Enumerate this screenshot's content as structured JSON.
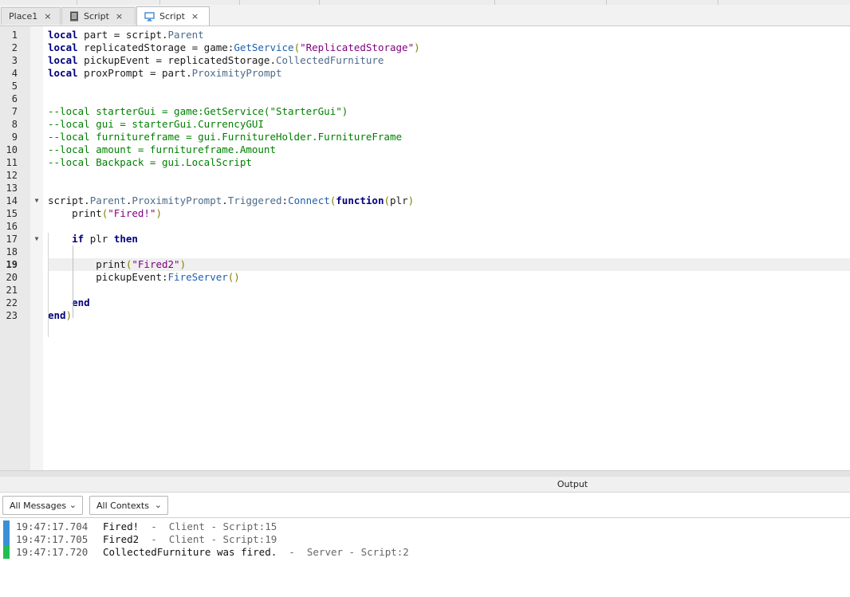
{
  "tabs": [
    {
      "label": "Place1",
      "icon": "none",
      "close": "×"
    },
    {
      "label": "Script",
      "icon": "script-doc-icon",
      "close": "×"
    },
    {
      "label": "Script",
      "icon": "monitor-icon",
      "close": "×"
    }
  ],
  "editor": {
    "current_line": 19,
    "lines": [
      {
        "n": "1",
        "fold": "",
        "html": "<span class='kw'>local</span> part = script.<span class='mem'>Parent</span>"
      },
      {
        "n": "2",
        "fold": "",
        "html": "<span class='kw'>local</span> replicatedStorage = game:<span class='meth'>GetService</span><span class='par'>(</span><span class='str'>\"ReplicatedStorage\"</span><span class='par'>)</span>"
      },
      {
        "n": "3",
        "fold": "",
        "html": "<span class='kw'>local</span> pickupEvent = replicatedStorage.<span class='mem'>CollectedFurniture</span>"
      },
      {
        "n": "4",
        "fold": "",
        "html": "<span class='kw'>local</span> proxPrompt = part.<span class='mem'>ProximityPrompt</span>"
      },
      {
        "n": "5",
        "fold": "",
        "html": ""
      },
      {
        "n": "6",
        "fold": "",
        "html": ""
      },
      {
        "n": "7",
        "fold": "",
        "html": "<span class='cmt'>--local starterGui = game:GetService(\"StarterGui\")</span>"
      },
      {
        "n": "8",
        "fold": "",
        "html": "<span class='cmt'>--local gui = starterGui.CurrencyGUI</span>"
      },
      {
        "n": "9",
        "fold": "",
        "html": "<span class='cmt'>--local furnitureframe = gui.FurnitureHolder.FurnitureFrame</span>"
      },
      {
        "n": "10",
        "fold": "",
        "html": "<span class='cmt'>--local amount = furnitureframe.Amount</span>"
      },
      {
        "n": "11",
        "fold": "",
        "html": "<span class='cmt'>--local Backpack = gui.LocalScript</span>"
      },
      {
        "n": "12",
        "fold": "",
        "html": ""
      },
      {
        "n": "13",
        "fold": "",
        "html": ""
      },
      {
        "n": "14",
        "fold": "▼",
        "html": "script.<span class='mem'>Parent</span>.<span class='mem'>ProximityPrompt</span>.<span class='mem'>Triggered</span>:<span class='meth'>Connect</span><span class='par'>(</span><span class='kw'>function</span><span class='par'>(</span>plr<span class='par'>)</span>"
      },
      {
        "n": "15",
        "fold": "",
        "html": "    print<span class='par'>(</span><span class='str'>\"Fired!\"</span><span class='par'>)</span>"
      },
      {
        "n": "16",
        "fold": "",
        "html": ""
      },
      {
        "n": "17",
        "fold": "▼",
        "html": "    <span class='kw'>if</span> plr <span class='kw'>then</span>"
      },
      {
        "n": "18",
        "fold": "",
        "html": ""
      },
      {
        "n": "19",
        "fold": "",
        "html": "        print<span class='par'>(</span><span class='str'>\"Fired2\"</span><span class='par'>)</span>"
      },
      {
        "n": "20",
        "fold": "",
        "html": "        pickupEvent:<span class='meth'>FireServer</span><span class='par'>()</span>"
      },
      {
        "n": "21",
        "fold": "",
        "html": ""
      },
      {
        "n": "22",
        "fold": "",
        "html": "    <span class='kw'>end</span>"
      },
      {
        "n": "23",
        "fold": "",
        "html": "<span class='kw'>end</span><span class='par'>)</span>"
      }
    ]
  },
  "output": {
    "title": "Output",
    "filter_messages": "All Messages",
    "filter_contexts": "All Contexts",
    "chevron": "⌄",
    "colors": {
      "client": "#3a8fd6",
      "server": "#1fbf4f"
    },
    "entries": [
      {
        "time": "19:47:17.704",
        "message": "Fired!",
        "source": "  -  Client - Script:15",
        "context": "client"
      },
      {
        "time": "19:47:17.705",
        "message": "Fired2",
        "source": "  -  Client - Script:19",
        "context": "client"
      },
      {
        "time": "19:47:17.720",
        "message": "CollectedFurniture was fired.",
        "source": "  -  Server - Script:2",
        "context": "server"
      }
    ]
  }
}
